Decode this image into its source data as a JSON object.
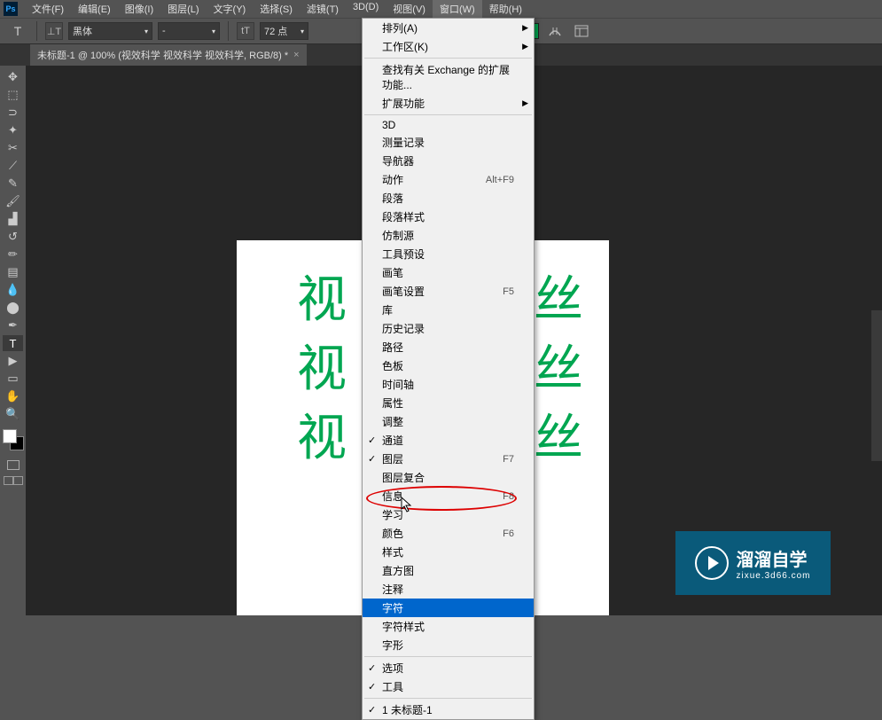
{
  "app": {
    "icon_label": "Ps"
  },
  "menubar": {
    "items": [
      "文件(F)",
      "编辑(E)",
      "图像(I)",
      "图层(L)",
      "文字(Y)",
      "选择(S)",
      "滤镜(T)",
      "3D(D)",
      "视图(V)",
      "窗口(W)",
      "帮助(H)"
    ],
    "active_index": 9
  },
  "options": {
    "tool_glyph": "T",
    "orient_glyph": "⊥T",
    "font": "黑体",
    "style": "-",
    "size_prefix": "tT",
    "size": "72 点",
    "color": "#00a651"
  },
  "tab": {
    "label": "未标题-1 @ 100% (视效科学 视效科学 视效科学, RGB/8) *"
  },
  "tools": {
    "items": [
      {
        "name": "move-tool",
        "glyph": "✥"
      },
      {
        "name": "marquee-tool",
        "glyph": "⬚"
      },
      {
        "name": "lasso-tool",
        "glyph": "⊃"
      },
      {
        "name": "magic-wand-tool",
        "glyph": "✦"
      },
      {
        "name": "crop-tool",
        "glyph": "✂"
      },
      {
        "name": "eyedropper-tool",
        "glyph": "⟋"
      },
      {
        "name": "healing-brush-tool",
        "glyph": "✎"
      },
      {
        "name": "brush-tool",
        "glyph": "🖌"
      },
      {
        "name": "clone-stamp-tool",
        "glyph": "▟"
      },
      {
        "name": "history-brush-tool",
        "glyph": "↺"
      },
      {
        "name": "eraser-tool",
        "glyph": "✏"
      },
      {
        "name": "gradient-tool",
        "glyph": "▤"
      },
      {
        "name": "blur-tool",
        "glyph": "💧"
      },
      {
        "name": "dodge-tool",
        "glyph": "⬤"
      },
      {
        "name": "pen-tool",
        "glyph": "✒"
      },
      {
        "name": "type-tool",
        "glyph": "T"
      },
      {
        "name": "path-selection-tool",
        "glyph": "▶"
      },
      {
        "name": "rectangle-tool",
        "glyph": "▭"
      },
      {
        "name": "hand-tool",
        "glyph": "✋"
      },
      {
        "name": "zoom-tool",
        "glyph": "🔍"
      }
    ],
    "selected_index": 15
  },
  "canvas_text": {
    "fragment": "视",
    "fragment_right": "丝"
  },
  "dropdown": {
    "sections": [
      {
        "items": [
          {
            "label": "排列(A)",
            "submenu": true
          },
          {
            "label": "工作区(K)",
            "submenu": true
          }
        ]
      },
      {
        "items": [
          {
            "label": "查找有关 Exchange 的扩展功能..."
          },
          {
            "label": "扩展功能",
            "submenu": true
          }
        ]
      },
      {
        "items": [
          {
            "label": "3D"
          },
          {
            "label": "测量记录"
          },
          {
            "label": "导航器"
          },
          {
            "label": "动作",
            "shortcut": "Alt+F9"
          },
          {
            "label": "段落"
          },
          {
            "label": "段落样式"
          },
          {
            "label": "仿制源"
          },
          {
            "label": "工具预设"
          },
          {
            "label": "画笔"
          },
          {
            "label": "画笔设置",
            "shortcut": "F5"
          },
          {
            "label": "库"
          },
          {
            "label": "历史记录"
          },
          {
            "label": "路径"
          },
          {
            "label": "色板"
          },
          {
            "label": "时间轴"
          },
          {
            "label": "属性"
          },
          {
            "label": "调整"
          },
          {
            "label": "通道",
            "checked": true
          },
          {
            "label": "图层",
            "checked": true,
            "shortcut": "F7"
          },
          {
            "label": "图层复合"
          },
          {
            "label": "信息",
            "shortcut": "F8"
          },
          {
            "label": "学习"
          },
          {
            "label": "颜色",
            "shortcut": "F6"
          },
          {
            "label": "样式"
          },
          {
            "label": "直方图"
          },
          {
            "label": "注释"
          },
          {
            "label": "字符",
            "highlighted": true
          },
          {
            "label": "字符样式"
          },
          {
            "label": "字形"
          }
        ]
      },
      {
        "items": [
          {
            "label": "选项",
            "checked": true
          },
          {
            "label": "工具",
            "checked": true
          }
        ]
      },
      {
        "items": [
          {
            "label": "1 未标题-1",
            "checked": true
          }
        ]
      }
    ]
  },
  "watermark": {
    "title": "溜溜自学",
    "sub": "zixue.3d66.com"
  }
}
